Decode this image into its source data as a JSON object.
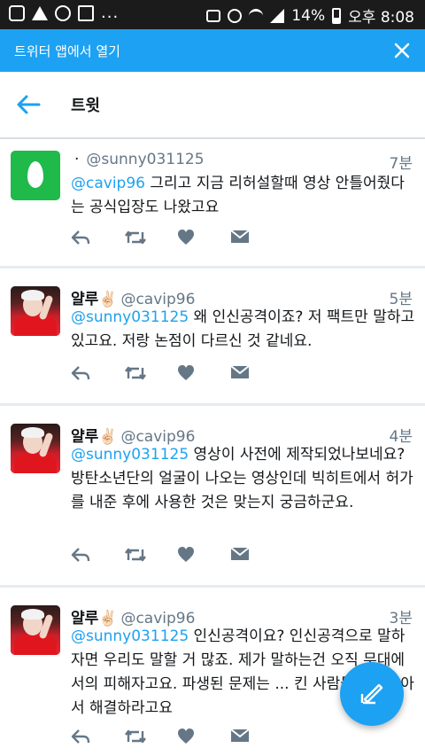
{
  "status_bar": {
    "dots": "...",
    "battery": "14%",
    "time": "오후 8:08"
  },
  "banner": {
    "label": "트위터 앱에서 열기",
    "close_icon": "close-icon"
  },
  "header": {
    "title": "트윗",
    "back_icon": "back-arrow-icon"
  },
  "tweets": [
    {
      "name": "",
      "separator": "·",
      "handle": "@sunny031125",
      "time": "7분",
      "avatar": "egg",
      "mention": "@cavip96",
      "text": " 그리고 지금 리허설할때 영상 안틀어줬다는 공식입장도 나왔고요"
    },
    {
      "name": "얄루✌🏻",
      "handle": "@cavip96",
      "time": "5분",
      "avatar": "photo",
      "mention": "@sunny031125",
      "text": " 왜 인신공격이죠? 저 팩트만 말하고 있고요. 저랑 논점이 다르신 것 같네요."
    },
    {
      "name": "얄루✌🏻",
      "handle": "@cavip96",
      "time": "4분",
      "avatar": "photo",
      "mention": "@sunny031125",
      "text": " 영상이 사전에 제작되었나보네요? 방탄소년단의 얼굴이 나오는 영상인데 빅히트에서 허가를 내준 후에 사용한 것은 맞는지 궁금하군요."
    },
    {
      "name": "얄루✌🏻",
      "handle": "@cavip96",
      "time": "3분",
      "avatar": "photo",
      "mention": "@sunny031125",
      "text": " 인신공격이요? 인신공격으로 말하자면 우리도 말할 거 많죠. 제가 말하는건 오직 무대에서의 피해자고요. 파생된 문제는 ... 킨 사람들끼리 알아서 해결하라고요"
    }
  ],
  "action_icons": [
    "reply-icon",
    "retweet-icon",
    "like-icon",
    "direct-message-icon"
  ],
  "fab_icon": "compose-tweet-icon",
  "colors": {
    "twitter_blue": "#1da1f2",
    "text": "#14171a",
    "secondary": "#657786",
    "egg_green": "#1fba4a"
  }
}
